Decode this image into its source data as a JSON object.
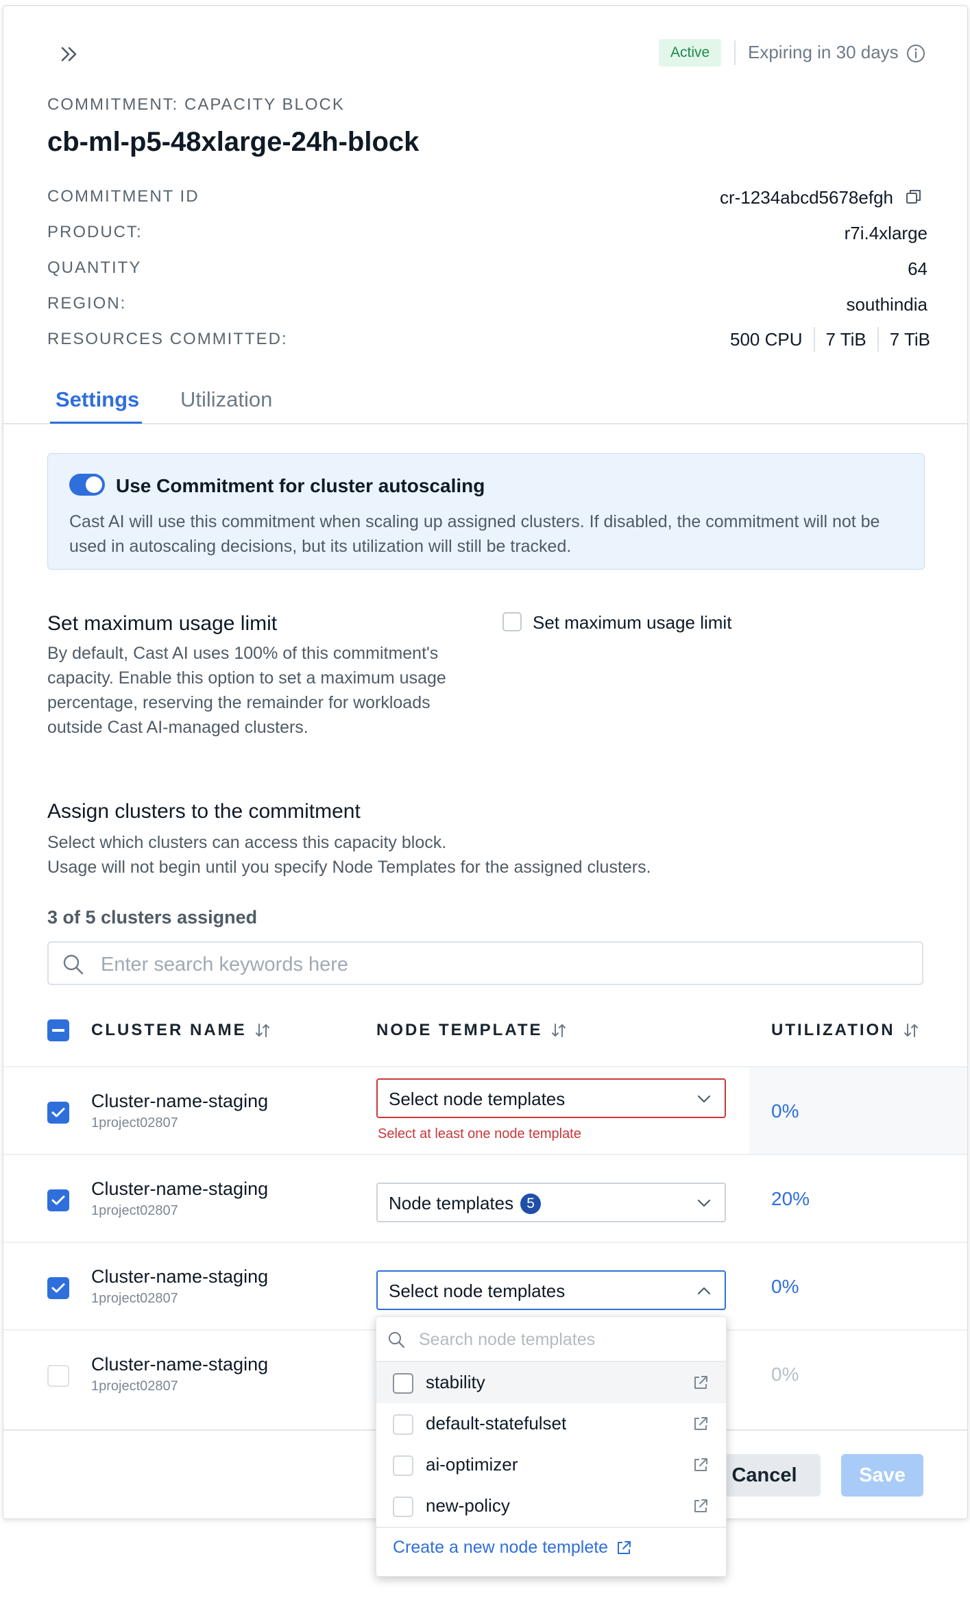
{
  "header": {
    "status_badge": "Active",
    "expiry_text": "Expiring in 30 days",
    "eyebrow": "COMMITMENT: CAPACITY BLOCK",
    "title": "cb-ml-p5-48xlarge-24h-block"
  },
  "meta": {
    "commitment_id_label": "COMMITMENT ID",
    "commitment_id_value": "cr-1234abcd5678efgh",
    "product_label": "PRODUCT:",
    "product_value": "r7i.4xlarge",
    "quantity_label": "QUANTITY",
    "quantity_value": "64",
    "region_label": "REGION:",
    "region_value": "southindia",
    "resources_label": "RESOURCES COMMITTED:",
    "resources": [
      "500 CPU",
      "7 TiB",
      "7 TiB"
    ]
  },
  "tabs": [
    {
      "label": "Settings",
      "active": true
    },
    {
      "label": "Utilization",
      "active": false
    }
  ],
  "autoscaling": {
    "enabled": true,
    "title": "Use Commitment for cluster autoscaling",
    "description": "Cast AI will use this commitment when scaling up assigned clusters. If disabled, the commitment will not be used in autoscaling decisions, but its utilization will still be tracked."
  },
  "usage_limit": {
    "title": "Set maximum usage limit",
    "description": "By default, Cast AI uses 100% of this commitment's capacity. Enable this option to set a maximum usage percentage, reserving the remainder for workloads outside Cast AI-managed clusters.",
    "checkbox_label": "Set maximum usage limit",
    "checked": false
  },
  "assign": {
    "title": "Assign clusters to the commitment",
    "description_line1": "Select which clusters can access this capacity block.",
    "description_line2": "Usage will not begin until you specify Node Templates for the assigned clusters.",
    "count_text": "3 of 5 clusters assigned",
    "search_placeholder": "Enter search keywords here"
  },
  "table": {
    "columns": [
      "CLUSTER NAME",
      "NODE TEMPLATE",
      "UTILIZATION"
    ],
    "rows": [
      {
        "name": "Cluster-name-staging",
        "project": "1project02807",
        "checked": true,
        "template": "Select node templates",
        "error": "Select at least one node template",
        "utilization": "0%"
      },
      {
        "name": "Cluster-name-staging",
        "project": "1project02807",
        "checked": true,
        "template": "Node templates",
        "template_count": "5",
        "utilization": "20%"
      },
      {
        "name": "Cluster-name-staging",
        "project": "1project02807",
        "checked": true,
        "template": "Select node templates",
        "utilization": "0%"
      },
      {
        "name": "Cluster-name-staging",
        "project": "1project02807",
        "checked": false,
        "utilization": "0%"
      }
    ]
  },
  "dropdown": {
    "search_placeholder": "Search node templates",
    "options": [
      "stability",
      "default-statefulset",
      "ai-optimizer",
      "new-policy"
    ],
    "create_link": "Create a new node templete"
  },
  "footer": {
    "cancel_label": "Cancel",
    "save_label": "Save"
  },
  "colors": {
    "accent": "#2f6fdc",
    "error": "#c9373a",
    "active_badge_bg": "#e3f6ea",
    "active_badge_text": "#1b8a4a"
  }
}
